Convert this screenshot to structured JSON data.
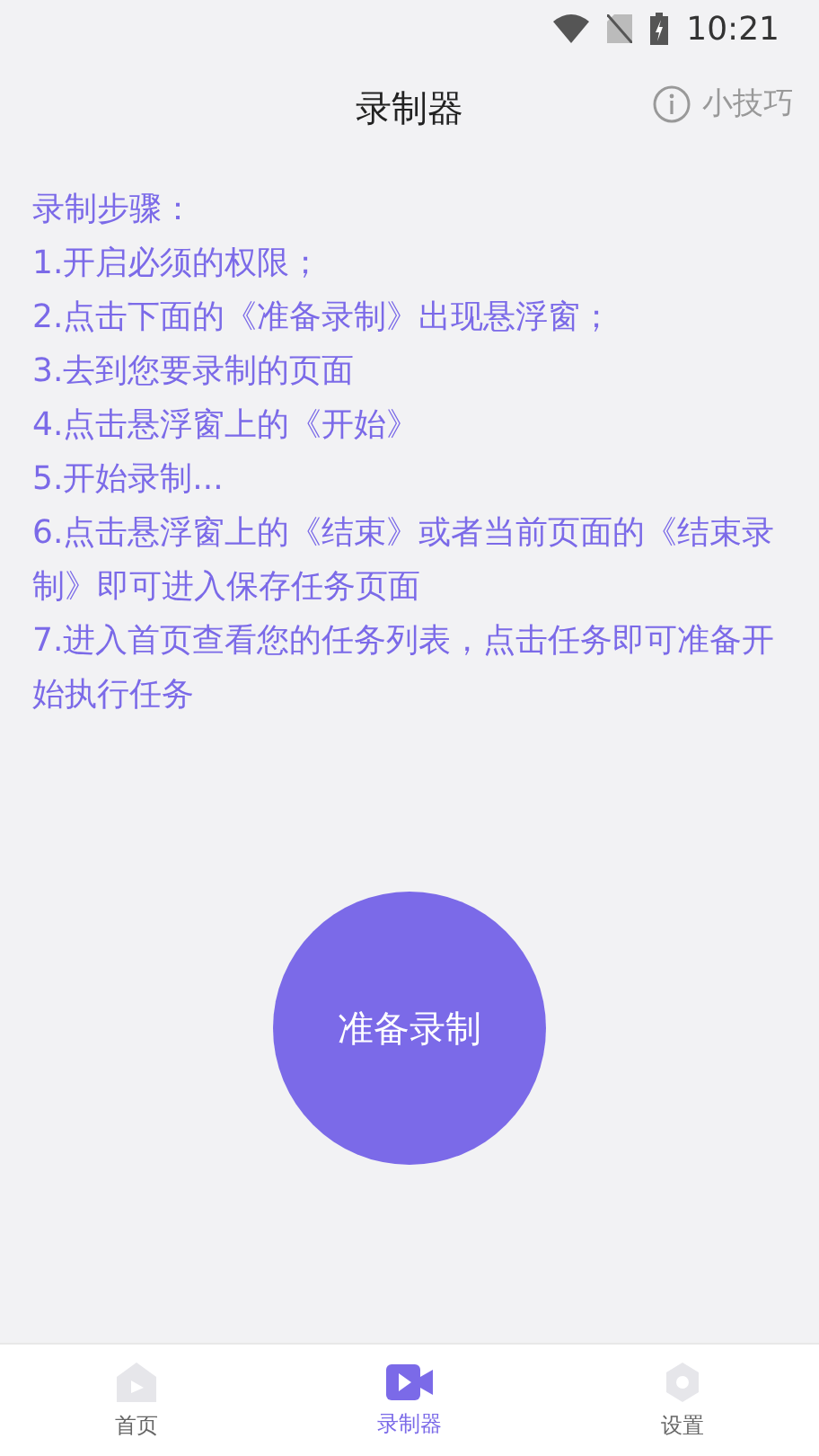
{
  "status_bar": {
    "time": "10:21"
  },
  "header": {
    "title": "录制器",
    "tips": "小技巧"
  },
  "instructions": [
    "录制步骤：",
    "1.开启必须的权限；",
    "2.点击下面的《准备录制》出现悬浮窗；",
    "3.去到您要录制的页面",
    "4.点击悬浮窗上的《开始》",
    "5.开始录制...",
    "6.点击悬浮窗上的《结束》或者当前页面的《结束录制》即可进入保存任务页面",
    "7.进入首页查看您的任务列表，点击任务即可准备开始执行任务"
  ],
  "record_button": "准备录制",
  "tabs": [
    {
      "label": "首页",
      "kind": "home",
      "selected": false
    },
    {
      "label": "录制器",
      "kind": "recorder",
      "selected": true
    },
    {
      "label": "设置",
      "kind": "settings",
      "selected": false
    }
  ]
}
